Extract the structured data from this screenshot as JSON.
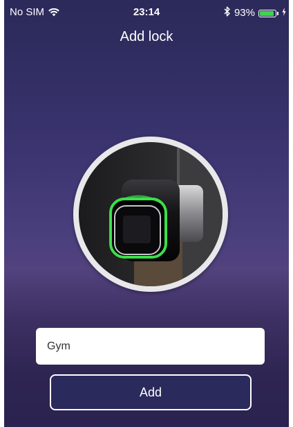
{
  "status_bar": {
    "carrier": "No SIM",
    "time": "23:14",
    "battery_percent": "93%",
    "battery_level": 0.93,
    "icons": [
      "wifi-icon",
      "bluetooth-icon",
      "battery-icon",
      "charging-icon"
    ]
  },
  "header": {
    "title": "Add lock"
  },
  "lock_image": {
    "icon": "lock-cylinder-illustration",
    "ring_color": "#3be04a"
  },
  "form": {
    "name_value": "Gym",
    "add_label": "Add"
  },
  "colors": {
    "accent": "#2a2a5c",
    "battery": "#3cd64b"
  }
}
